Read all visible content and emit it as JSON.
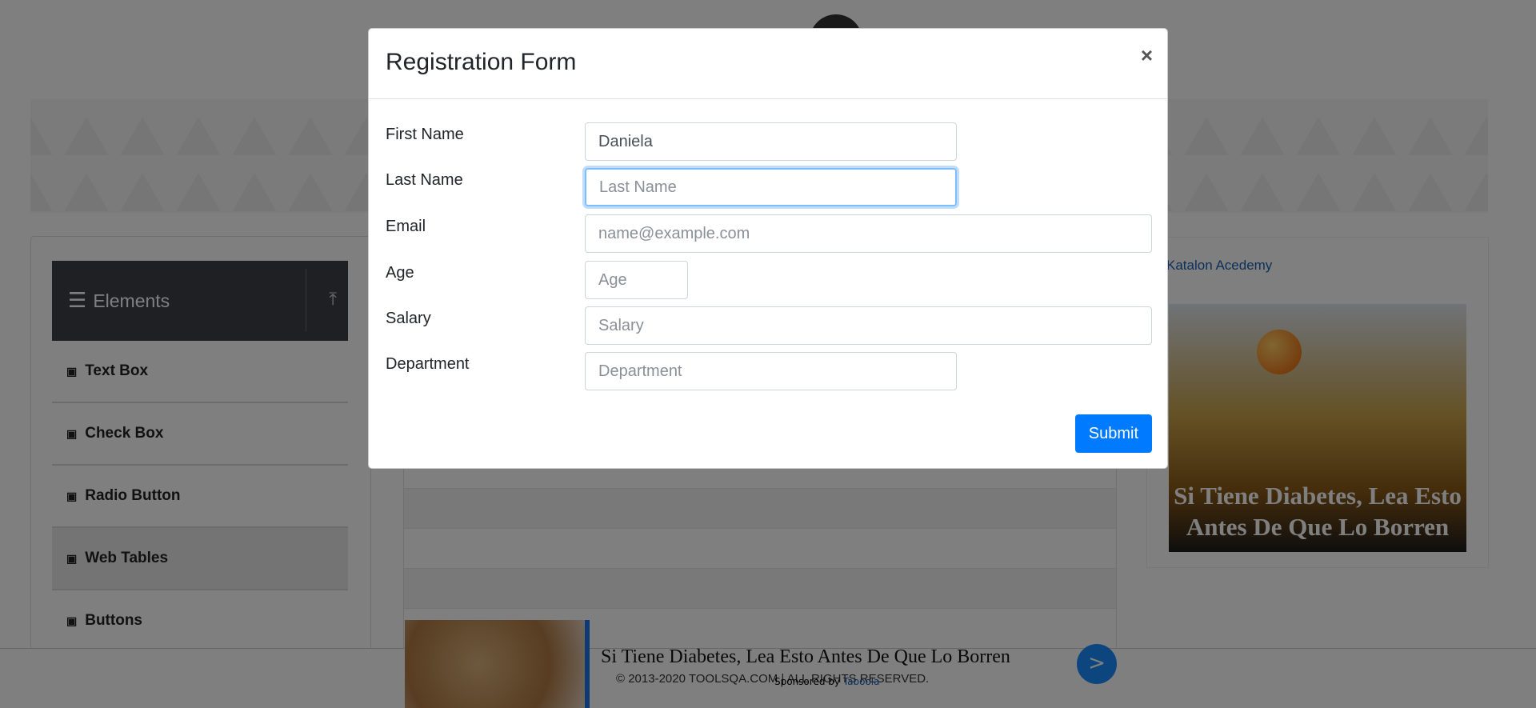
{
  "sidebar": {
    "header_title": "Elements",
    "items": [
      {
        "label": "Text Box"
      },
      {
        "label": "Check Box"
      },
      {
        "label": "Radio Button"
      },
      {
        "label": "Web Tables"
      },
      {
        "label": "Buttons"
      }
    ]
  },
  "right_ad": {
    "link_text": "Katalon Acedemy",
    "headline": "Si Tiene Diabetes, Lea Esto Antes De Que Lo Borren"
  },
  "bottom_ad": {
    "title": "Si Tiene Diabetes, Lea Esto Antes De Que Lo Borren",
    "button_label": ">",
    "sponsored_prefix": "Sponsored by",
    "sponsored_brand": "Taboola"
  },
  "footer": {
    "text": "© 2013-2020 TOOLSQA.COM | ALL RIGHTS RESERVED."
  },
  "modal": {
    "title": "Registration Form",
    "close_label": "×",
    "fields": {
      "first_name": {
        "label": "First Name",
        "value": "Daniela",
        "placeholder": "First Name"
      },
      "last_name": {
        "label": "Last Name",
        "value": "",
        "placeholder": "Last Name"
      },
      "email": {
        "label": "Email",
        "value": "",
        "placeholder": "name@example.com"
      },
      "age": {
        "label": "Age",
        "value": "",
        "placeholder": "Age"
      },
      "salary": {
        "label": "Salary",
        "value": "",
        "placeholder": "Salary"
      },
      "department": {
        "label": "Department",
        "value": "",
        "placeholder": "Department"
      }
    },
    "submit_label": "Submit"
  }
}
